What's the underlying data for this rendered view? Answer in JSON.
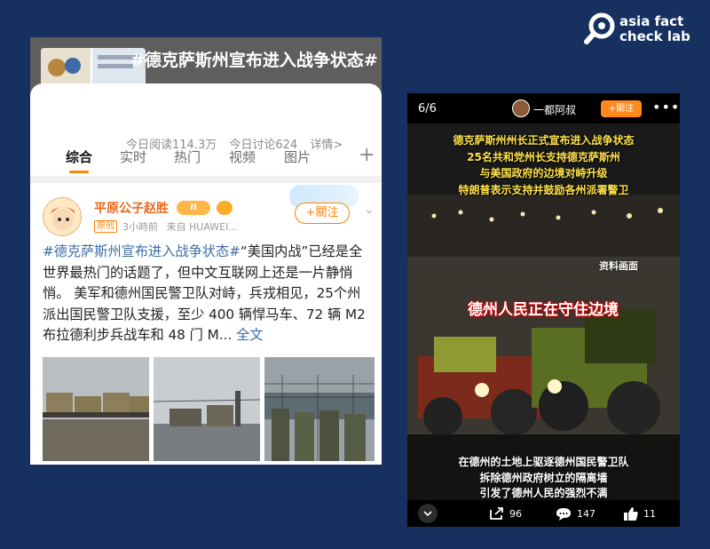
{
  "logo": {
    "line1": "asia fact",
    "line2": "check lab",
    "icon": "magnifier-icon"
  },
  "weibo": {
    "topic": {
      "title": "#德克萨斯州宣布进入战争状态#",
      "reads": "今日阅读114.3万",
      "discussions": "今日讨论624",
      "details": "详情>"
    },
    "tabs": [
      {
        "label": "综合",
        "active": true
      },
      {
        "label": "实时",
        "active": false
      },
      {
        "label": "热门",
        "active": false
      },
      {
        "label": "视频",
        "active": false
      },
      {
        "label": "图片",
        "active": false
      }
    ],
    "tab_plus": "+",
    "post": {
      "author": "平原公子赵胜",
      "badge": "II",
      "orig_tag": "原创",
      "time": "3小時前",
      "source": "来自 HUAWEI...",
      "follow": "+關注",
      "topic_link": "#德克萨斯州宣布进入战争状态#",
      "text": "“美国内战”已经是全世界最热门的话题了，但中文互联网上还是一片静悄悄。  美军和德州国民警卫队对峙，兵戎相见，25个州派出国民警卫队支援，至少 400 辆悍马车、72 辆 M2 布拉德利步兵战车和 48 门 M...",
      "more": "全文"
    },
    "colors": {
      "accent": "#ff8200",
      "link": "#3a6ea5",
      "name": "#e86b1b"
    }
  },
  "douyin": {
    "page": "6/6",
    "user": "一都阿叔",
    "follow": "+關注",
    "captions_top": [
      "德克萨斯州州长正式宣布进入战争状态",
      "25名共和党州长支持德克萨斯州",
      "与美国政府的边境对峙升级",
      "特朗普表示支持并鼓励各州派署警卫"
    ],
    "source_tag": "资料画面",
    "headline": "德州人民正在守住边境",
    "captions_bottom": [
      "在德州的土地上驱逐德州国民警卫队",
      "拆除德州政府树立的隔离墙",
      "引发了德州人民的强烈不满"
    ],
    "shares": "96",
    "comments": "147",
    "likes": "11"
  }
}
